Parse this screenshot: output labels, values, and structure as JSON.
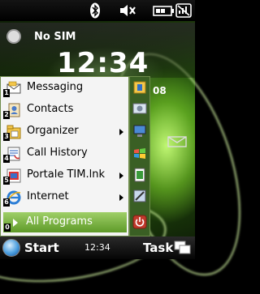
{
  "status_bar": {
    "icons": [
      "bluetooth-icon",
      "volume-muted-icon",
      "battery-icon",
      "signal-off-icon"
    ]
  },
  "today": {
    "sim_status": "No SIM",
    "clock_time": "12:34",
    "peek_number": "08"
  },
  "start_menu": {
    "items": [
      {
        "label": "Messaging",
        "icon": "messaging-icon",
        "shortcut": "1",
        "submenu": false
      },
      {
        "label": "Contacts",
        "icon": "contacts-icon",
        "shortcut": "2",
        "submenu": false
      },
      {
        "label": "Organizer",
        "icon": "organizer-icon",
        "shortcut": "3",
        "submenu": true
      },
      {
        "label": "Call History",
        "icon": "call-history-icon",
        "shortcut": "4",
        "submenu": false
      },
      {
        "label": "Portale TIM.lnk",
        "icon": "portale-tim-icon",
        "shortcut": "5",
        "submenu": true
      },
      {
        "label": "Internet",
        "icon": "internet-explorer-icon",
        "shortcut": "6",
        "submenu": true
      }
    ],
    "all_programs_label": "All Programs",
    "all_programs_shortcut": "0"
  },
  "taskbar": {
    "start_label": "Start",
    "time": "12:34",
    "task_label": "Task"
  },
  "colors": {
    "accent_green": "#5e9a28",
    "menu_background": "#f4f4f4"
  }
}
